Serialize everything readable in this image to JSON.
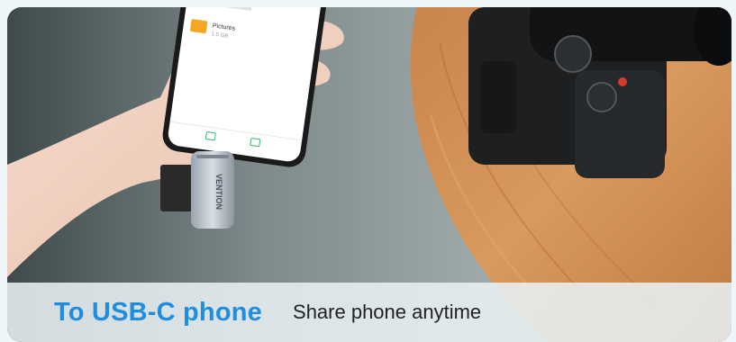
{
  "caption": {
    "title": "To USB-C phone",
    "subtitle": "Share phone anytime"
  },
  "phone_screen": {
    "items": [
      {
        "name": "Pictures",
        "detail": "1.5 GB"
      }
    ],
    "bottom_tabs": [
      "",
      ""
    ]
  },
  "adapter": {
    "brand": "VENTION"
  },
  "colors": {
    "accent": "#1f8ee0",
    "caption_bg": "#e8f0f4",
    "folder": "#f5a623"
  }
}
